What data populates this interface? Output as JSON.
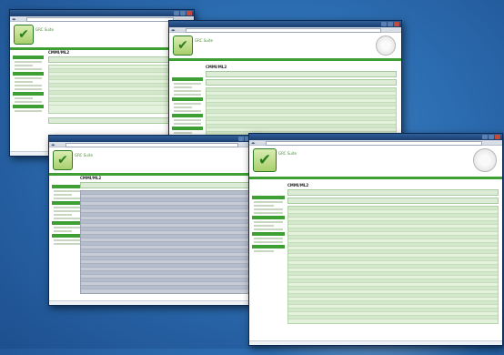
{
  "screens": [
    {
      "app_name": "GRC Suite",
      "page_heading": "CMMI/ML2"
    },
    {
      "app_name": "GRC Suite",
      "page_heading": "CMMI/ML2"
    },
    {
      "app_name": "GRC Suite",
      "page_heading": "CMMI/ML2"
    },
    {
      "app_name": "GRC Suite",
      "page_heading": "CMMI/ML2"
    }
  ],
  "colors": {
    "brand_green": "#3ea034",
    "panel_green": "#e3f2dc",
    "desktop_blue": "#2c6cb0"
  },
  "icons": [
    "checkmark-logo-icon",
    "certification-seal-icon",
    "window-close-icon"
  ]
}
